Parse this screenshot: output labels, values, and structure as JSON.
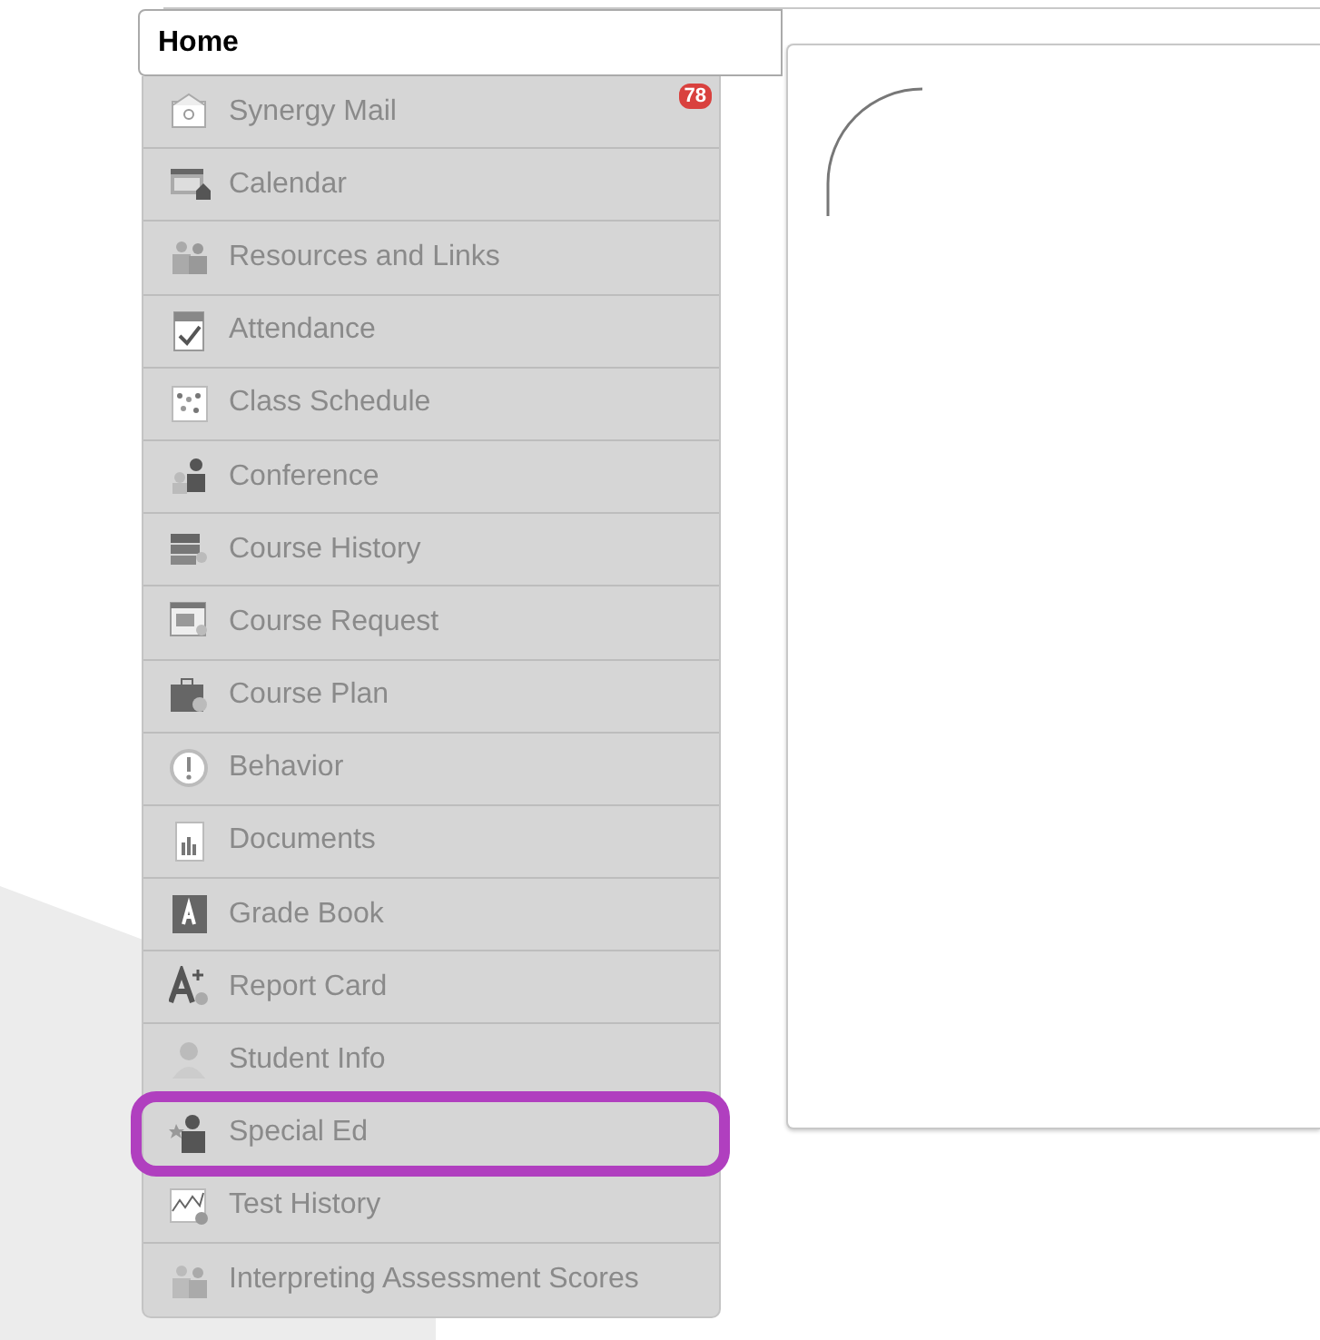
{
  "header": {
    "title": "Home"
  },
  "sidebar": {
    "items": [
      {
        "label": "Synergy Mail",
        "badge": "78",
        "highlighted": false
      },
      {
        "label": "Calendar",
        "highlighted": false
      },
      {
        "label": "Resources and Links",
        "highlighted": false
      },
      {
        "label": "Attendance",
        "highlighted": false
      },
      {
        "label": "Class Schedule",
        "highlighted": false
      },
      {
        "label": "Conference",
        "highlighted": false
      },
      {
        "label": "Course History",
        "highlighted": false
      },
      {
        "label": "Course Request",
        "highlighted": false
      },
      {
        "label": "Course Plan",
        "highlighted": false
      },
      {
        "label": "Behavior",
        "highlighted": false
      },
      {
        "label": "Documents",
        "highlighted": false
      },
      {
        "label": "Grade Book",
        "highlighted": false
      },
      {
        "label": "Report Card",
        "highlighted": false
      },
      {
        "label": "Student Info",
        "highlighted": false
      },
      {
        "label": "Special Ed",
        "highlighted": true
      },
      {
        "label": "Test History",
        "highlighted": false
      },
      {
        "label": "Interpreting Assessment Scores",
        "highlighted": false
      }
    ]
  }
}
